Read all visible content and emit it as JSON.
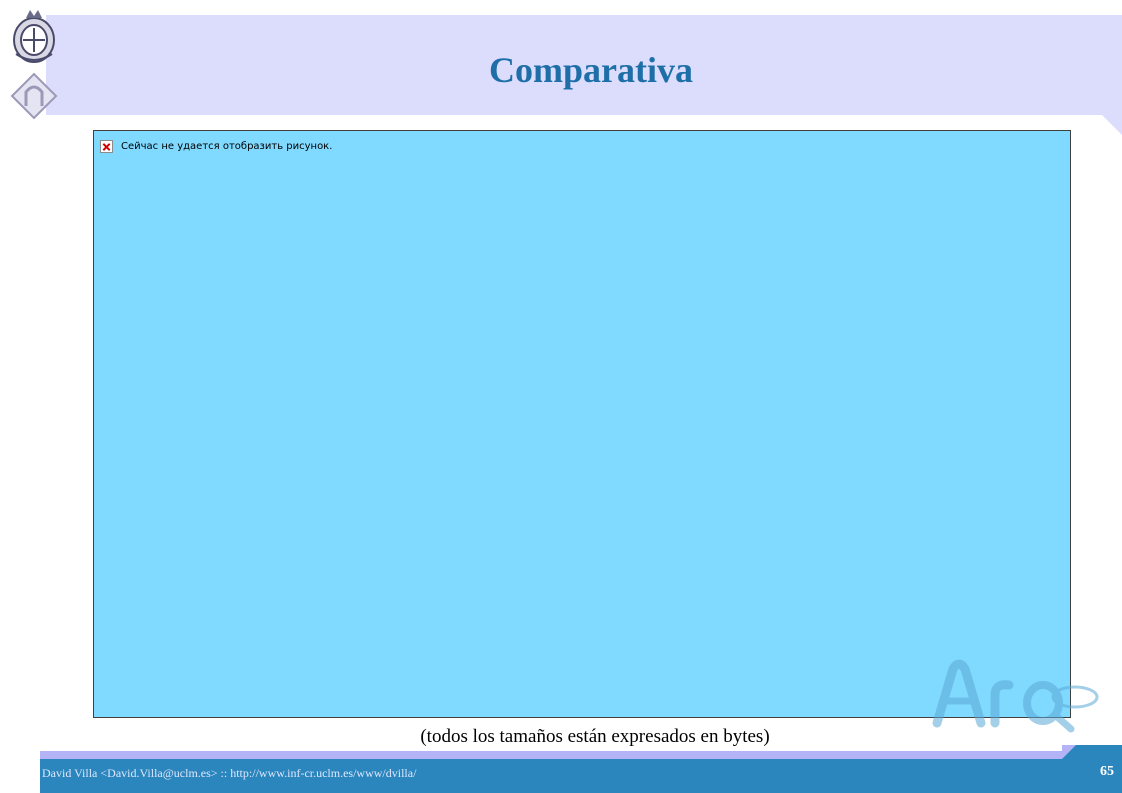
{
  "slide": {
    "title": "Comparativa",
    "broken_image_text": "Сейчас не удается отобразить рисунок.",
    "caption": "(todos los tamaños están expresados en bytes)"
  },
  "footer": {
    "author": "David Villa <David.Villa@uclm.es> :: http://www.inf-cr.uclm.es/www/dvilla/",
    "page_number": "65"
  },
  "colors": {
    "header_band": "#dcdcfc",
    "title": "#1e6fa8",
    "image_placeholder": "#80d9ff",
    "footer_band": "#2a86bc"
  },
  "icons": {
    "top_logo": "university-crest-logo",
    "broken_image": "broken-image-icon",
    "watermark": "arco-group-logo"
  }
}
